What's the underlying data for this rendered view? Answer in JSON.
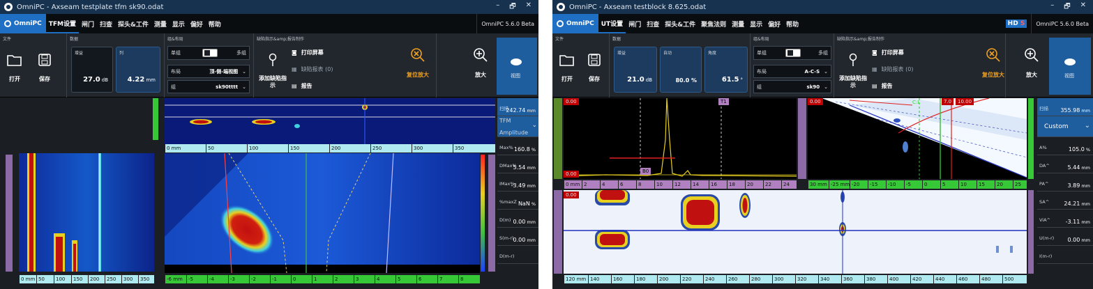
{
  "left": {
    "title": "OmniPC - Axseam testplate tfm sk90.odat",
    "window_controls": [
      "–",
      "🗗",
      "✕"
    ],
    "logo": "OmniPC",
    "menu": [
      "TFM设置",
      "闸门",
      "扫查",
      "探头&工件",
      "测量",
      "显示",
      "偏好",
      "帮助"
    ],
    "version": "OmniPC 5.6.0 Beta",
    "ribbon": {
      "file_section": "文件",
      "open": "打开",
      "save": "保存",
      "data_section": "数据",
      "gain_label": "增益",
      "gain_value": "27.0",
      "gain_unit": "dB",
      "col_label": "列",
      "col_value": "4.22",
      "col_unit": "mm",
      "group_section": "组&布局",
      "single": "单组",
      "multi": "多组",
      "layout_label": "布局",
      "layout_value": "顶-侧-端视图",
      "group_label": "组",
      "group_value": "sk90tttt",
      "defect_section": "缺陷指示&amp;报告制作",
      "add_defect": "添加缺陷指示",
      "print": "打印屏幕",
      "defect_table": "缺陷报表 (0)",
      "report": "报告",
      "reset_zoom": "复位放大",
      "zoom": "放大",
      "view": "视图"
    },
    "side_panel": {
      "scan_label": "扫描",
      "scan_value": "242.74",
      "scan_unit": "mm",
      "mode_line1": "TFM",
      "mode_line2": "Amplitude",
      "items": [
        {
          "label": "Max%",
          "value": "160.8",
          "unit": "%"
        },
        {
          "label": "DMax%",
          "value": "5.54",
          "unit": "mm"
        },
        {
          "label": "IMax%",
          "value": "-3.49",
          "unit": "mm"
        },
        {
          "label": "%maxZ",
          "value": "NaN",
          "unit": "%"
        },
        {
          "label": "D(m)",
          "value": "0.00",
          "unit": "mm"
        },
        {
          "label": "S(m-r)",
          "value": "0.00",
          "unit": "mm"
        },
        {
          "label": "D(m-r)",
          "value": "",
          "unit": ""
        }
      ]
    },
    "top_ruler": [
      "0 mm",
      "50",
      "100",
      "150",
      "200",
      "250",
      "300",
      "350"
    ],
    "bottom_ruler_left": [
      "0 mm",
      "50",
      "100",
      "150",
      "200",
      "250",
      "300",
      "350"
    ],
    "bottom_ruler_right": [
      "-6 mm",
      "-5",
      "-4",
      "-3",
      "-2",
      "-1",
      "0",
      "1",
      "2",
      "3",
      "4",
      "5",
      "6",
      "7",
      "8"
    ]
  },
  "right": {
    "title": "OmniPC - Axseam  testblock  8.625.odat",
    "window_controls": [
      "–",
      "🗗",
      "✕"
    ],
    "logo": "OmniPC",
    "menu": [
      "UT设置",
      "闸门",
      "扫查",
      "探头&工件",
      "聚焦法则",
      "测量",
      "显示",
      "偏好",
      "帮助"
    ],
    "hd": "HD",
    "hd_s": "S",
    "version": "OmniPC 5.6.0 Beta",
    "ribbon": {
      "file_section": "文件",
      "open": "打开",
      "save": "保存",
      "data_section": "数据",
      "gain_label": "增益",
      "gain_value": "21.0",
      "gain_unit": "dB",
      "auto_label": "自动",
      "auto_value": "80.0 %",
      "angle_label": "角度",
      "angle_value": "61.5",
      "angle_unit": "°",
      "group_section": "组&布局",
      "single": "单组",
      "multi": "多组",
      "layout_label": "布局",
      "layout_value": "A-C-S",
      "group_label": "组",
      "group_value": "sk90",
      "defect_section": "缺陷指示&amp;报告制作",
      "add_defect": "添加缺陷指示",
      "print": "打印屏幕",
      "defect_table": "缺陷报表 (0)",
      "report": "报告",
      "reset_zoom": "复位放大",
      "zoom": "放大",
      "view": "视图"
    },
    "side_panel": {
      "scan_label": "扫描",
      "scan_value": "355.98",
      "scan_unit": "mm",
      "mode": "Custom",
      "items": [
        {
          "label": "A%",
          "value": "105.0",
          "unit": "%"
        },
        {
          "label": "DA^",
          "value": "5.44",
          "unit": "mm"
        },
        {
          "label": "PA^",
          "value": "3.89",
          "unit": "mm"
        },
        {
          "label": "SA^",
          "value": "24.21",
          "unit": "mm"
        },
        {
          "label": "ViA^",
          "value": "-3.11",
          "unit": "mm"
        },
        {
          "label": "U(m-r)",
          "value": "0.00",
          "unit": "mm"
        },
        {
          "label": "I(m-r)",
          "value": "",
          "unit": ""
        }
      ]
    },
    "ascan_markers": {
      "r": "0.00",
      "m": "0.00",
      "t1": "T1",
      "b0": "B0",
      "cl": "C:L",
      "ang": "7.0",
      "ang2": "10.00"
    },
    "ascan_ruler": [
      "0 mm",
      "2",
      "4",
      "6",
      "8",
      "10",
      "12",
      "14",
      "16",
      "18",
      "20",
      "22",
      "24"
    ],
    "sscan_ruler": [
      "30 mm",
      "-25 mm",
      "-20",
      "-15",
      "-10",
      "-5",
      "0",
      "5",
      "10",
      "15",
      "20",
      "25"
    ],
    "bottom_ruler": [
      "120 mm",
      "140",
      "160",
      "180",
      "200",
      "220",
      "240",
      "260",
      "280",
      "300",
      "320",
      "340",
      "360",
      "380",
      "400",
      "420",
      "440",
      "460",
      "480",
      "500"
    ]
  }
}
